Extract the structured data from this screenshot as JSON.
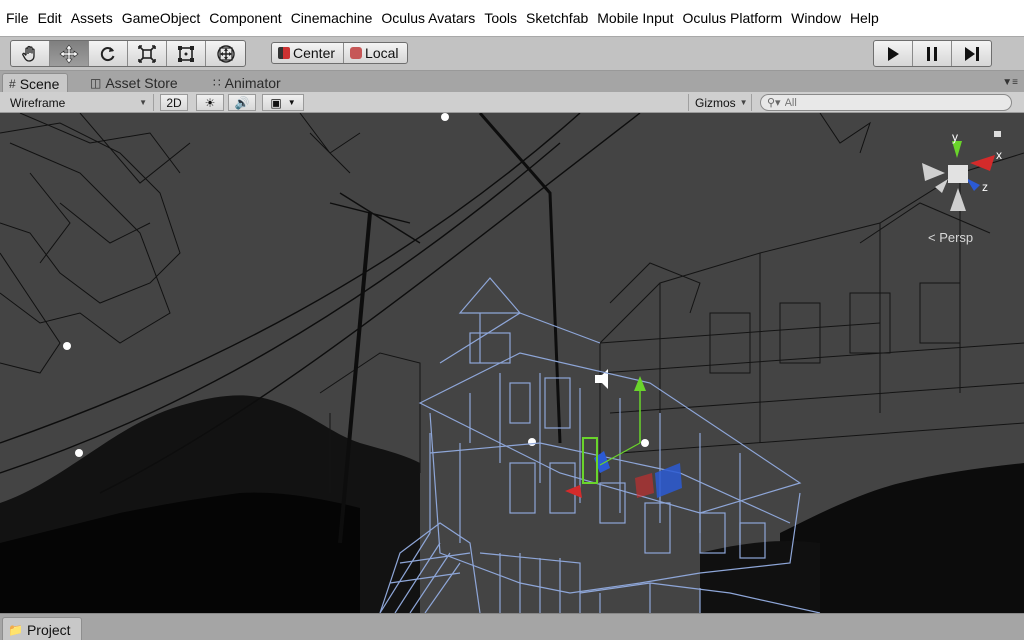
{
  "menubar": {
    "items": [
      "File",
      "Edit",
      "Assets",
      "GameObject",
      "Component",
      "Cinemachine",
      "Oculus Avatars",
      "Tools",
      "Sketchfab",
      "Mobile Input",
      "Oculus Platform",
      "Window",
      "Help"
    ]
  },
  "toolbar": {
    "tools": [
      {
        "icon": "hand-icon",
        "active": false
      },
      {
        "icon": "move-icon",
        "active": true
      },
      {
        "icon": "rotate-icon",
        "active": false
      },
      {
        "icon": "scale-icon",
        "active": false
      },
      {
        "icon": "rect-tool-icon",
        "active": false
      },
      {
        "icon": "transform-tool-icon",
        "active": false
      }
    ],
    "pivot_label": "Center",
    "space_label": "Local",
    "play_icons": [
      "play-icon",
      "pause-icon",
      "step-icon"
    ]
  },
  "tabs": [
    {
      "label": "Scene",
      "icon": "scene-icon",
      "active": true
    },
    {
      "label": "Asset Store",
      "icon": "asset-store-icon",
      "active": false
    },
    {
      "label": "Animator",
      "icon": "animator-icon",
      "active": false
    }
  ],
  "scene_header": {
    "draw_mode": "Wireframe",
    "mode_2d": "2D",
    "gizmos_label": "Gizmos",
    "search_placeholder": "All"
  },
  "viewport": {
    "persp_label": "< Persp",
    "gizmo_axes": {
      "y": "y",
      "x": "x",
      "z": "z"
    },
    "colors": {
      "background": "#444444",
      "wire": "#000000",
      "selected_wire": "#8ea6d8",
      "axis_x": "#d42b2b",
      "axis_y": "#6ad42b",
      "axis_z": "#2b5ad4"
    }
  },
  "bottom": {
    "project_label": "Project"
  }
}
